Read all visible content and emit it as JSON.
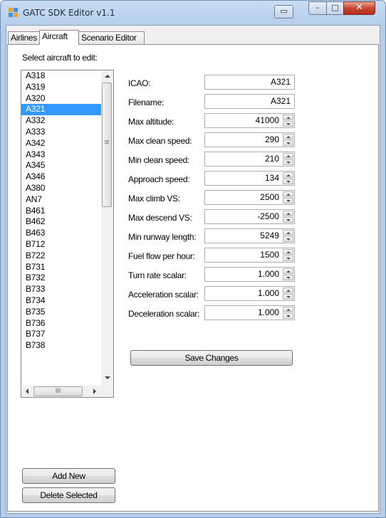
{
  "window": {
    "title": "GATC SDK Editor v1.1",
    "buttons": {
      "help": "▭",
      "minimize": "–",
      "maximize": "□",
      "close": "✕"
    }
  },
  "tabs": [
    {
      "label": "Airlines",
      "active": false
    },
    {
      "label": "Aircraft",
      "active": true
    },
    {
      "label": "Scenario Editor",
      "active": false
    }
  ],
  "aircraft_panel": {
    "select_label": "Select aircraft to edit:",
    "aircraft_list": [
      "A318",
      "A319",
      "A320",
      "A321",
      "A332",
      "A333",
      "A342",
      "A343",
      "A345",
      "A346",
      "A380",
      "AN7",
      "B461",
      "B462",
      "B463",
      "B712",
      "B722",
      "B731",
      "B732",
      "B733",
      "B734",
      "B735",
      "B736",
      "B737",
      "B738"
    ],
    "selected": "A321",
    "hscroll_thumb": "III",
    "fields": {
      "icao": {
        "label": "ICAO:",
        "value": "A321"
      },
      "filename": {
        "label": "Filename:",
        "value": "A321"
      },
      "max_altitude": {
        "label": "Max altitude:",
        "value": "41000"
      },
      "max_clean_speed": {
        "label": "Max clean speed:",
        "value": "290"
      },
      "min_clean_speed": {
        "label": "Min clean speed:",
        "value": "210"
      },
      "approach_speed": {
        "label": "Approach speed:",
        "value": "134"
      },
      "max_climb_vs": {
        "label": "Max climb VS:",
        "value": "2500"
      },
      "max_descend_vs": {
        "label": "Max descend VS:",
        "value": "-2500"
      },
      "min_runway_length": {
        "label": "Min runway length:",
        "value": "5249"
      },
      "fuel_flow_per_hour": {
        "label": "Fuel flow per hour:",
        "value": "1500"
      },
      "turn_rate_scalar": {
        "label": "Turn rate scalar:",
        "value": "1.000"
      },
      "acceleration_scalar": {
        "label": "Acceleration scalar:",
        "value": "1.000"
      },
      "deceleration_scalar": {
        "label": "Deceleration scalar:",
        "value": "1.000"
      }
    },
    "save_button": "Save Changes",
    "add_new_button": "Add New",
    "delete_selected_button": "Delete Selected"
  },
  "colors": {
    "selection": "#3399ff",
    "titlebar": "#c9dcf2",
    "close_button": "#c7462f"
  }
}
